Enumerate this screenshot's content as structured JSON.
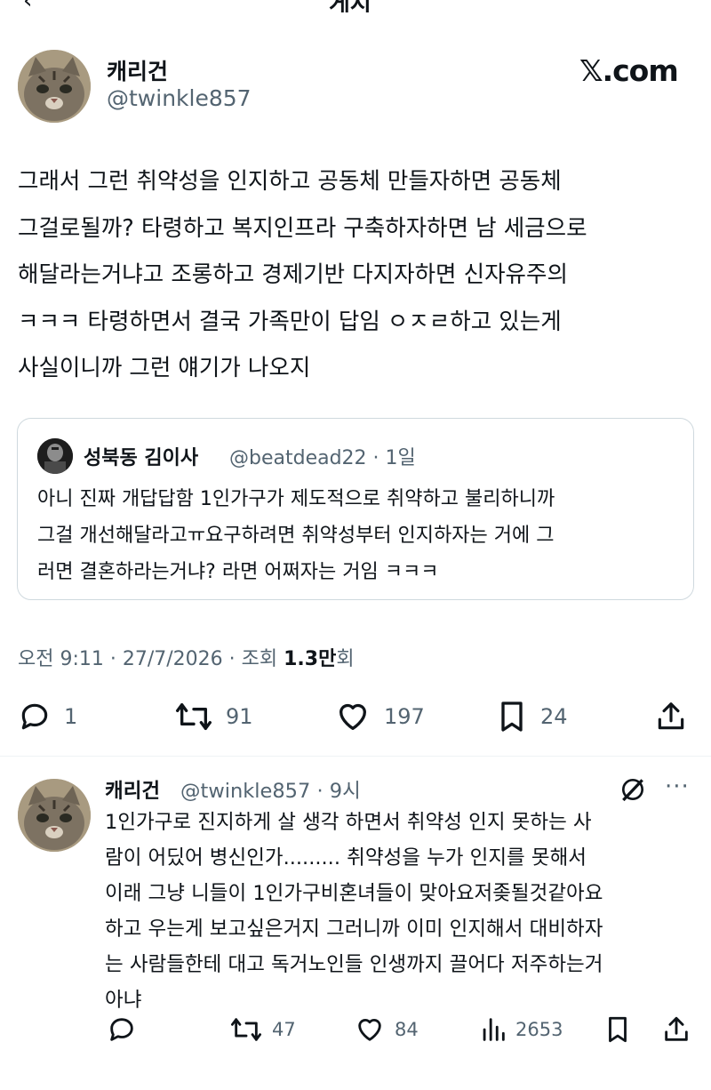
{
  "header": {
    "back_icon": "arrow-left-icon",
    "title": "게시"
  },
  "tweet": {
    "author_name": "캐리건",
    "author_handle": "@twinkle857",
    "brand": "𝕏.com",
    "text": "그래서 그런 취약성을 인지하고 공동체 만들자하면 공동체\n그걸로될까? 타령하고 복지인프라 구축하자하면 남 세금으로\n해달라는거냐고 조롱하고 경제기반 다지자하면 신자유주의\nㅋㅋㅋ 타령하면서 결국 가족만이 답임 ㅇㅈㄹ하고 있는게\n사실이니까 그런 얘기가 나오지",
    "quote": {
      "author_name": "성북동 김이사",
      "author_handle": "@beatdead22 · 1일",
      "text": "아니 진짜 개답답함 1인가구가 제도적으로 취약하고 불리하니까\n그걸 개선해달라고ㅠ요구하려면 취약성부터 인지하자는 거에 그\n러면 결혼하라는거냐? 라면 어쩌자는 거임 ㅋㅋㅋ"
    },
    "meta": {
      "time_date": "오전 9:11 · 27/7/2026 · 조회 ",
      "views": "1.3만",
      "views_suffix": "회"
    },
    "actions": {
      "replies": "1",
      "reposts": "91",
      "likes": "197",
      "bookmarks": "24"
    }
  },
  "reply": {
    "author_name": "캐리건",
    "author_handle": "@twinkle857 · 9시",
    "text": "1인가구로 진지하게 살 생각 하면서 취약성 인지 못하는 사\n람이 어딨어 병신인가......... 취약성을 누가 인지를 못해서\n이래 그냥 니들이 1인가구비혼녀들이 맞아요저좆될것같아요\n하고 우는게 보고싶은거지 그러니까 이미 인지해서 대비하자\n는 사람들한테 대고 독거노인들 인생까지 끌어다 저주하는거\n아냐",
    "actions": {
      "reposts": "47",
      "likes": "84",
      "views": "2653"
    }
  },
  "colors": {
    "text": "#0f1419",
    "secondary": "#536471",
    "border": "#cfd9de"
  }
}
